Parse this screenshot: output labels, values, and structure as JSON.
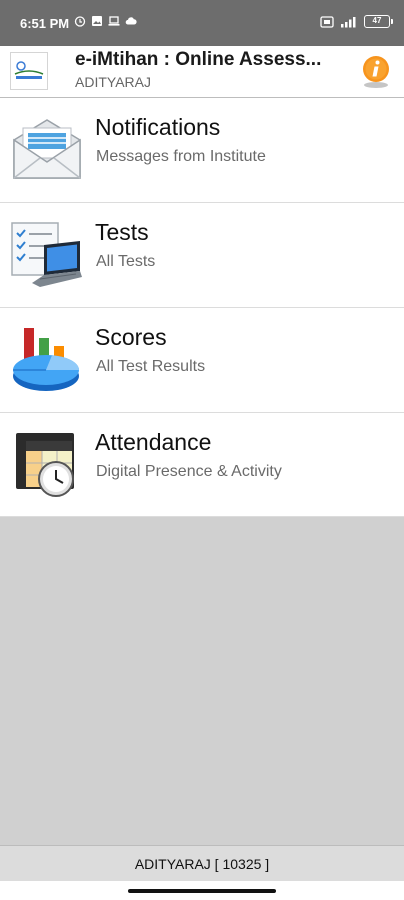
{
  "status_bar": {
    "time": "6:51 PM",
    "battery": "47",
    "icons": [
      "alarm-icon",
      "gallery-icon",
      "laptop-icon",
      "cloud-icon",
      "sim-icon",
      "signal-icon",
      "battery-icon"
    ]
  },
  "app_bar": {
    "title": "e-iMtihan : Online Assess...",
    "subtitle": "ADITYARAJ",
    "info_icon": "info-icon",
    "accent": "#f7941d"
  },
  "menu": {
    "items": [
      {
        "title": "Notifications",
        "description": "Messages from Institute",
        "icon": "envelope-icon"
      },
      {
        "title": "Tests",
        "description": "All Tests",
        "icon": "laptop-checklist-icon"
      },
      {
        "title": "Scores",
        "description": "All Test Results",
        "icon": "bar-pie-chart-icon"
      },
      {
        "title": "Attendance",
        "description": "Digital Presence & Activity",
        "icon": "calendar-clock-icon"
      }
    ]
  },
  "footer": {
    "text": "ADITYARAJ [ 10325 ]"
  },
  "colors": {
    "status_bar": "#6d6d6d",
    "background": "#d0d0d0",
    "footer": "#dcdcdc"
  }
}
